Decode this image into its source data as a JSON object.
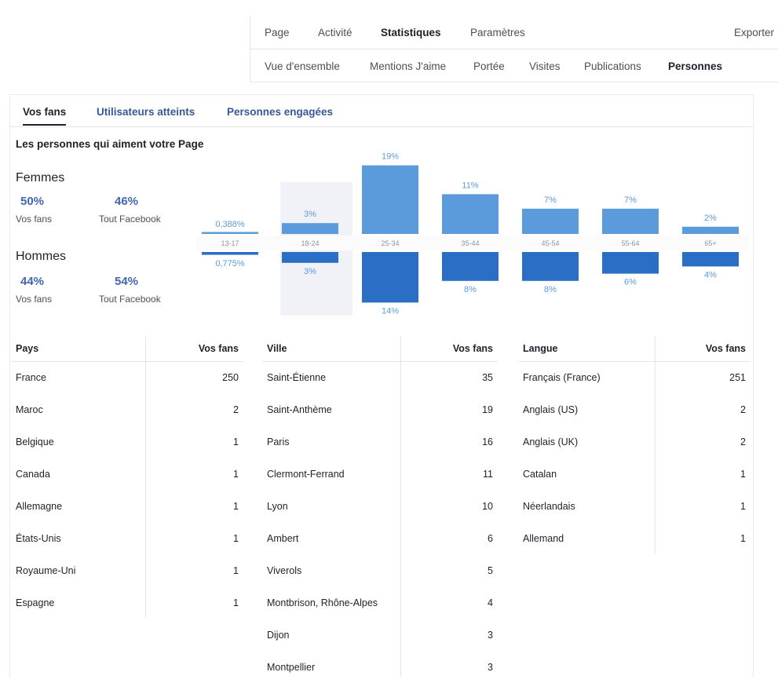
{
  "top_nav": {
    "row1": [
      "Page",
      "Activité",
      "Statistiques",
      "Paramètres"
    ],
    "row1_active": "Statistiques",
    "export_label": "Exporter",
    "row2": [
      "Vue d'ensemble",
      "Mentions J'aime",
      "Portée",
      "Visites",
      "Publications",
      "Personnes"
    ],
    "row2_active": "Personnes"
  },
  "sub_tabs": [
    "Vos fans",
    "Utilisateurs atteints",
    "Personnes engagées"
  ],
  "sub_tabs_active": "Vos fans",
  "section_title": "Les personnes qui aiment votre Page",
  "women": {
    "label": "Femmes",
    "fans_pct": "50%",
    "fans_label": "Vos fans",
    "facebook_pct": "46%",
    "facebook_label": "Tout Facebook"
  },
  "men": {
    "label": "Hommes",
    "fans_pct": "44%",
    "fans_label": "Vos fans",
    "facebook_pct": "54%",
    "facebook_label": "Tout Facebook"
  },
  "chart_data": {
    "type": "bar",
    "categories": [
      "13-17",
      "18-24",
      "25-34",
      "35-44",
      "45-54",
      "55-64",
      "65+"
    ],
    "series": [
      {
        "name": "Femmes",
        "values": [
          0.388,
          3,
          19,
          11,
          7,
          7,
          2
        ],
        "labels": [
          "0,388%",
          "3%",
          "19%",
          "11%",
          "7%",
          "7%",
          "2%"
        ],
        "color": "#5b9bdc"
      },
      {
        "name": "Hommes",
        "values": [
          0.775,
          3,
          14,
          8,
          8,
          6,
          4
        ],
        "labels": [
          "0,775%",
          "3%",
          "14%",
          "8%",
          "8%",
          "6%",
          "4%"
        ],
        "color": "#2a6ec5"
      }
    ],
    "highlighted_category": "18-24"
  },
  "tables": [
    {
      "col1": "Pays",
      "col2": "Vos fans",
      "rows": [
        [
          "France",
          "250"
        ],
        [
          "Maroc",
          "2"
        ],
        [
          "Belgique",
          "1"
        ],
        [
          "Canada",
          "1"
        ],
        [
          "Allemagne",
          "1"
        ],
        [
          "États-Unis",
          "1"
        ],
        [
          "Royaume-Uni",
          "1"
        ],
        [
          "Espagne",
          "1"
        ]
      ]
    },
    {
      "col1": "Ville",
      "col2": "Vos fans",
      "rows": [
        [
          "Saint-Étienne",
          "35"
        ],
        [
          "Saint-Anthème",
          "19"
        ],
        [
          "Paris",
          "16"
        ],
        [
          "Clermont-Ferrand",
          "11"
        ],
        [
          "Lyon",
          "10"
        ],
        [
          "Ambert",
          "6"
        ],
        [
          "Viverols",
          "5"
        ],
        [
          "Montbrison, Rhône-Alpes",
          "4"
        ],
        [
          "Dijon",
          "3"
        ],
        [
          "Montpellier",
          "3"
        ]
      ]
    },
    {
      "col1": "Langue",
      "col2": "Vos fans",
      "rows": [
        [
          "Français (France)",
          "251"
        ],
        [
          "Anglais (US)",
          "2"
        ],
        [
          "Anglais (UK)",
          "2"
        ],
        [
          "Catalan",
          "1"
        ],
        [
          "Néerlandais",
          "1"
        ],
        [
          "Allemand",
          "1"
        ]
      ]
    }
  ]
}
